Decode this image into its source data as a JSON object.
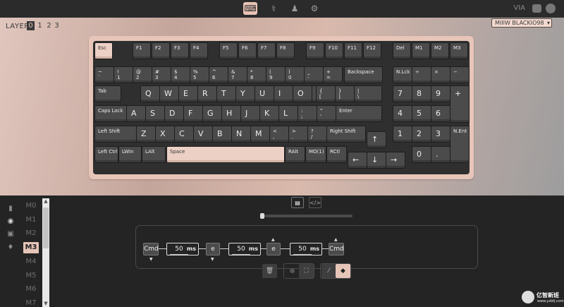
{
  "app": {
    "brand": "VIA"
  },
  "nav": [
    {
      "name": "configure-nav-icon",
      "glyph": "⌨",
      "active": true
    },
    {
      "name": "test-nav-icon",
      "glyph": "⚕",
      "active": false
    },
    {
      "name": "design-nav-icon",
      "glyph": "♟",
      "active": false
    },
    {
      "name": "settings-nav-icon",
      "glyph": "⚙",
      "active": false
    }
  ],
  "layers": {
    "label": "LAYER",
    "items": [
      "0",
      "1",
      "2",
      "3"
    ],
    "active": "0"
  },
  "keyboard_select": {
    "value": "MIIIW BLACKIO98",
    "chevron": "▾"
  },
  "keys": [
    {
      "t": "Esc",
      "light": true
    },
    {
      "t": "F1"
    },
    {
      "t": "F2"
    },
    {
      "t": "F3"
    },
    {
      "t": "F4"
    },
    {
      "t": "F5"
    },
    {
      "t": "F6"
    },
    {
      "t": "F7"
    },
    {
      "t": "F8"
    },
    {
      "t": "F9"
    },
    {
      "t": "F10"
    },
    {
      "t": "F11"
    },
    {
      "t": "F12"
    },
    {
      "t": "Del"
    },
    {
      "t": "M1"
    },
    {
      "t": "M2"
    },
    {
      "t": "M3"
    },
    {
      "t": "~\n`"
    },
    {
      "t": "!\n1"
    },
    {
      "t": "@\n2"
    },
    {
      "t": "#\n3"
    },
    {
      "t": "$\n4"
    },
    {
      "t": "%\n5"
    },
    {
      "t": "^\n6"
    },
    {
      "t": "&\n7"
    },
    {
      "t": "*\n8"
    },
    {
      "t": "(\n9"
    },
    {
      "t": ")\n0"
    },
    {
      "t": "_\n-"
    },
    {
      "t": "+\n="
    },
    {
      "t": "Backspace"
    },
    {
      "t": "N.Lck"
    },
    {
      "t": "÷"
    },
    {
      "t": "×"
    },
    {
      "t": "−"
    },
    {
      "t": "Tab"
    },
    {
      "t": "Q",
      "big": true
    },
    {
      "t": "W",
      "big": true
    },
    {
      "t": "E",
      "big": true
    },
    {
      "t": "R",
      "big": true
    },
    {
      "t": "T",
      "big": true
    },
    {
      "t": "Y",
      "big": true
    },
    {
      "t": "U",
      "big": true
    },
    {
      "t": "I",
      "big": true
    },
    {
      "t": "O",
      "big": true
    },
    {
      "t": "P",
      "big": true
    },
    {
      "t": "{\n["
    },
    {
      "t": "}\n]"
    },
    {
      "t": "|\n\\"
    },
    {
      "t": "7",
      "big": true
    },
    {
      "t": "8",
      "big": true
    },
    {
      "t": "9",
      "big": true
    },
    {
      "t": "+",
      "big": true
    },
    {
      "t": "Caps Lock"
    },
    {
      "t": "A",
      "big": true
    },
    {
      "t": "S",
      "big": true
    },
    {
      "t": "D",
      "big": true
    },
    {
      "t": "F",
      "big": true
    },
    {
      "t": "G",
      "big": true
    },
    {
      "t": "H",
      "big": true
    },
    {
      "t": "J",
      "big": true
    },
    {
      "t": "K",
      "big": true
    },
    {
      "t": "L",
      "big": true
    },
    {
      "t": ":\n;"
    },
    {
      "t": "\"\n'"
    },
    {
      "t": "Enter"
    },
    {
      "t": "4",
      "big": true
    },
    {
      "t": "5",
      "big": true
    },
    {
      "t": "6",
      "big": true
    },
    {
      "t": "Left Shift"
    },
    {
      "t": "Z",
      "big": true
    },
    {
      "t": "X",
      "big": true
    },
    {
      "t": "C",
      "big": true
    },
    {
      "t": "V",
      "big": true
    },
    {
      "t": "B",
      "big": true
    },
    {
      "t": "N",
      "big": true
    },
    {
      "t": "M",
      "big": true
    },
    {
      "t": "<\n,"
    },
    {
      "t": ">\n."
    },
    {
      "t": "?\n/"
    },
    {
      "t": "Right Shift"
    },
    {
      "t": "↑",
      "big": true
    },
    {
      "t": "1",
      "big": true
    },
    {
      "t": "2",
      "big": true
    },
    {
      "t": "3",
      "big": true
    },
    {
      "t": "N.Ent"
    },
    {
      "t": "Left Ctrl"
    },
    {
      "t": "LWin"
    },
    {
      "t": "LAlt"
    },
    {
      "t": "Space",
      "light": true
    },
    {
      "t": "RAlt"
    },
    {
      "t": "MO(1)"
    },
    {
      "t": "RCtl"
    },
    {
      "t": "←",
      "big": true
    },
    {
      "t": "↓",
      "big": true
    },
    {
      "t": "→",
      "big": true
    },
    {
      "t": "0",
      "big": true
    },
    {
      "t": ".",
      "big": true
    }
  ],
  "sidebar": [
    {
      "name": "keymap-side-icon",
      "glyph": "▮",
      "active": false
    },
    {
      "name": "macros-side-icon",
      "glyph": "◉",
      "active": true
    },
    {
      "name": "save-load-side-icon",
      "glyph": "▣",
      "active": false
    },
    {
      "name": "lighting-side-icon",
      "glyph": "♦",
      "active": false
    }
  ],
  "macros": {
    "items": [
      "M0",
      "M1",
      "M2",
      "M3",
      "M4",
      "M5",
      "M6",
      "M7"
    ],
    "active": "M3"
  },
  "editor_tabs": [
    {
      "name": "recorder-tab-icon",
      "glyph": "▤",
      "active": true
    },
    {
      "name": "script-tab-icon",
      "glyph": "</>",
      "active": false
    }
  ],
  "macro_sequence": {
    "keys": [
      "Cmd",
      "e",
      "e",
      "Cmd"
    ],
    "delays": [
      "50",
      "50",
      "50"
    ],
    "unit": "ms"
  },
  "actions": {
    "delete": "🗑",
    "record": "●",
    "fullscreen": "⛶",
    "smart_delay": "⁄",
    "tap_mode": "◆"
  },
  "watermark": {
    "brand": "亿智新班",
    "sub": "www.yzbfj.com"
  }
}
